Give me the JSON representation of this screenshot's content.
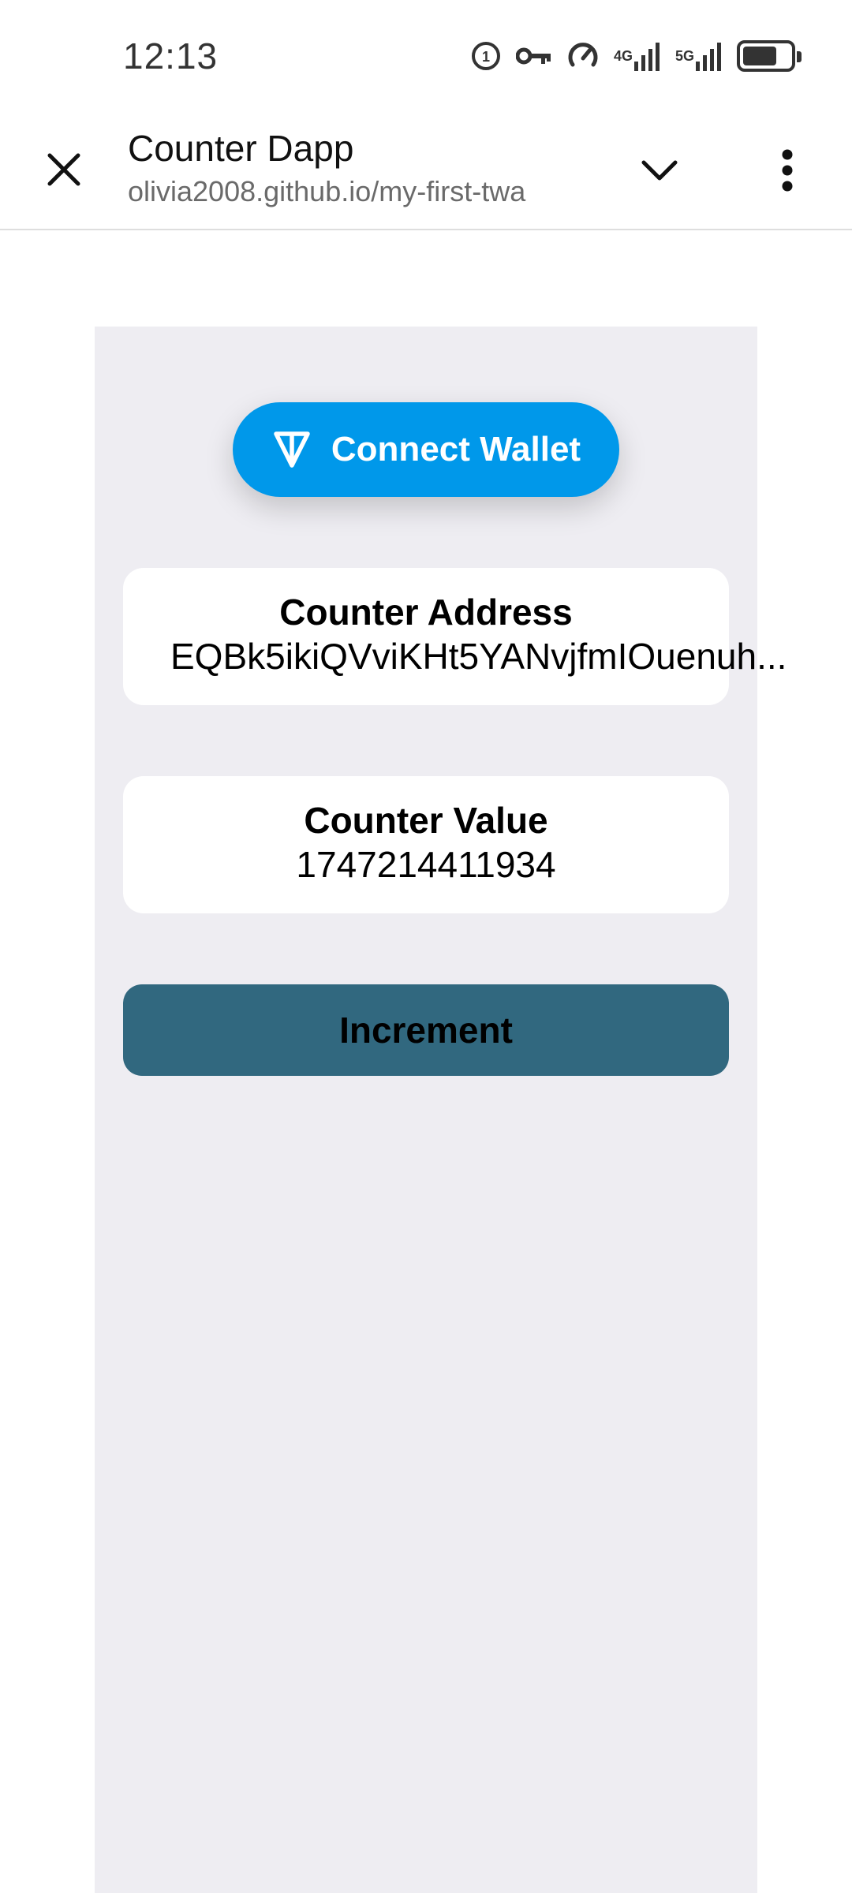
{
  "status_bar": {
    "time": "12:13",
    "icons": [
      "hd-call-icon",
      "vpn-key-icon",
      "data-saver-icon",
      "signal-4g-icon",
      "signal-5g-icon",
      "battery-icon"
    ],
    "net1": "4G",
    "net2": "5G",
    "battery_level": 0.65
  },
  "toolbar": {
    "title": "Counter Dapp",
    "url": "olivia2008.github.io/my-first-twa"
  },
  "page": {
    "connect_wallet_label": "Connect Wallet",
    "address_title": "Counter Address",
    "address_value": "EQBk5ikiQVviKHt5YANvjfmIOuenuh...",
    "counter_title": "Counter Value",
    "counter_value": "1747214411934",
    "increment_label": "Increment"
  },
  "colors": {
    "wallet_button": "#0098ea",
    "increment_button": "#31687f",
    "content_bg": "#eeedf2"
  }
}
